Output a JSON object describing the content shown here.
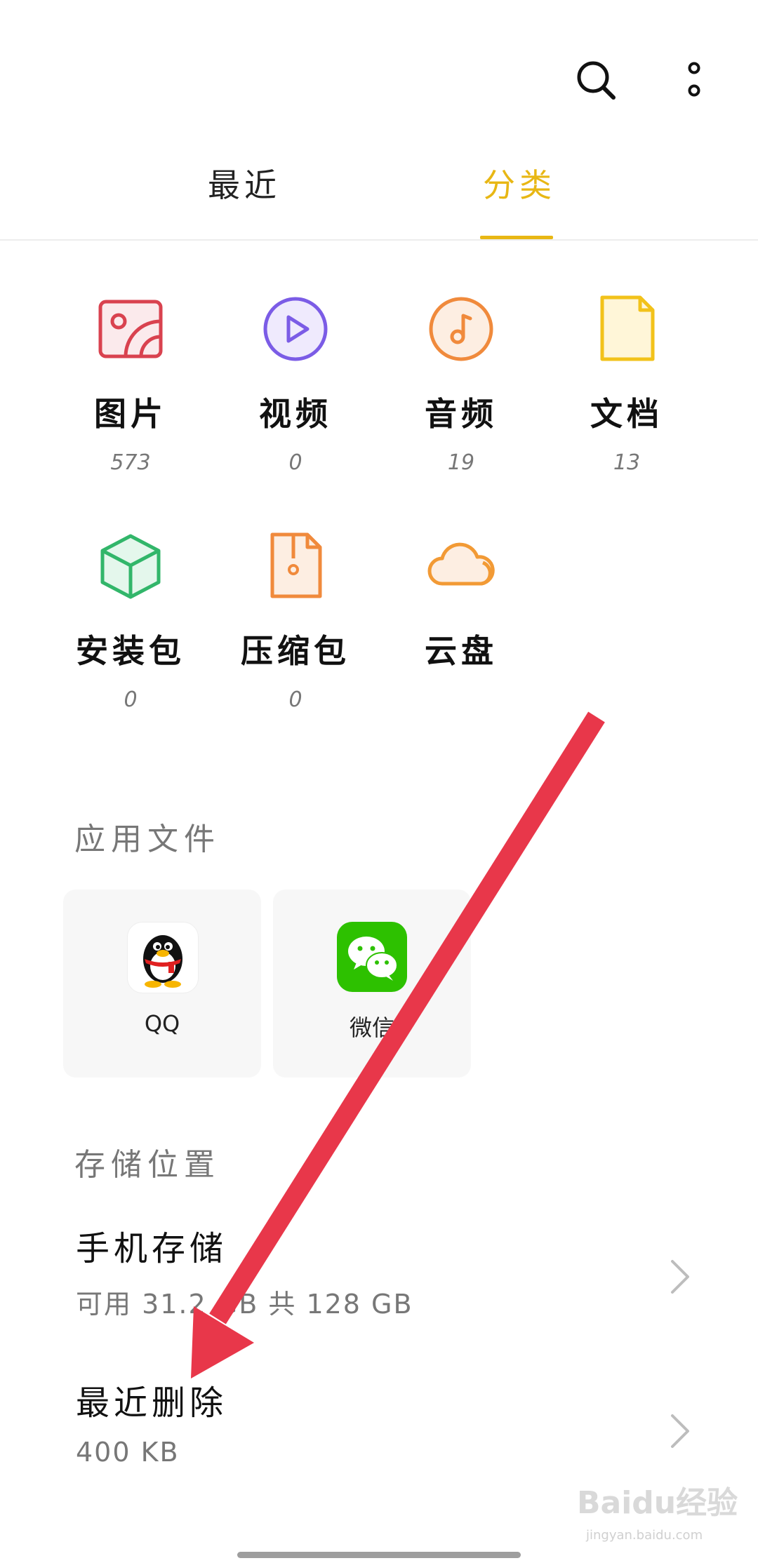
{
  "tabs": [
    {
      "label": "最近",
      "active": false
    },
    {
      "label": "分类",
      "active": true
    }
  ],
  "colors": {
    "accent": "#e8b714",
    "arrow": "#e8374a"
  },
  "categories": [
    {
      "label": "图片",
      "count": "573",
      "icon": "image-icon"
    },
    {
      "label": "视频",
      "count": "0",
      "icon": "video-play-icon"
    },
    {
      "label": "音频",
      "count": "19",
      "icon": "music-note-icon"
    },
    {
      "label": "文档",
      "count": "13",
      "icon": "document-icon"
    },
    {
      "label": "安装包",
      "count": "0",
      "icon": "package-cube-icon"
    },
    {
      "label": "压缩包",
      "count": "0",
      "icon": "zip-file-icon"
    },
    {
      "label": "云盘",
      "icon": "cloud-icon"
    }
  ],
  "app_files": {
    "title": "应用文件",
    "apps": [
      {
        "label": "QQ",
        "icon": "qq-penguin-icon"
      },
      {
        "label": "微信",
        "icon": "wechat-icon"
      }
    ]
  },
  "storage": {
    "title": "存储位置",
    "phone": {
      "title": "手机存储",
      "detail": "可用 31.2 GB   共 128 GB"
    },
    "recent_deleted": {
      "title": "最近删除",
      "detail": "400 KB"
    }
  },
  "watermark": {
    "text": "Baidu经验",
    "sub": "jingyan.baidu.com"
  }
}
